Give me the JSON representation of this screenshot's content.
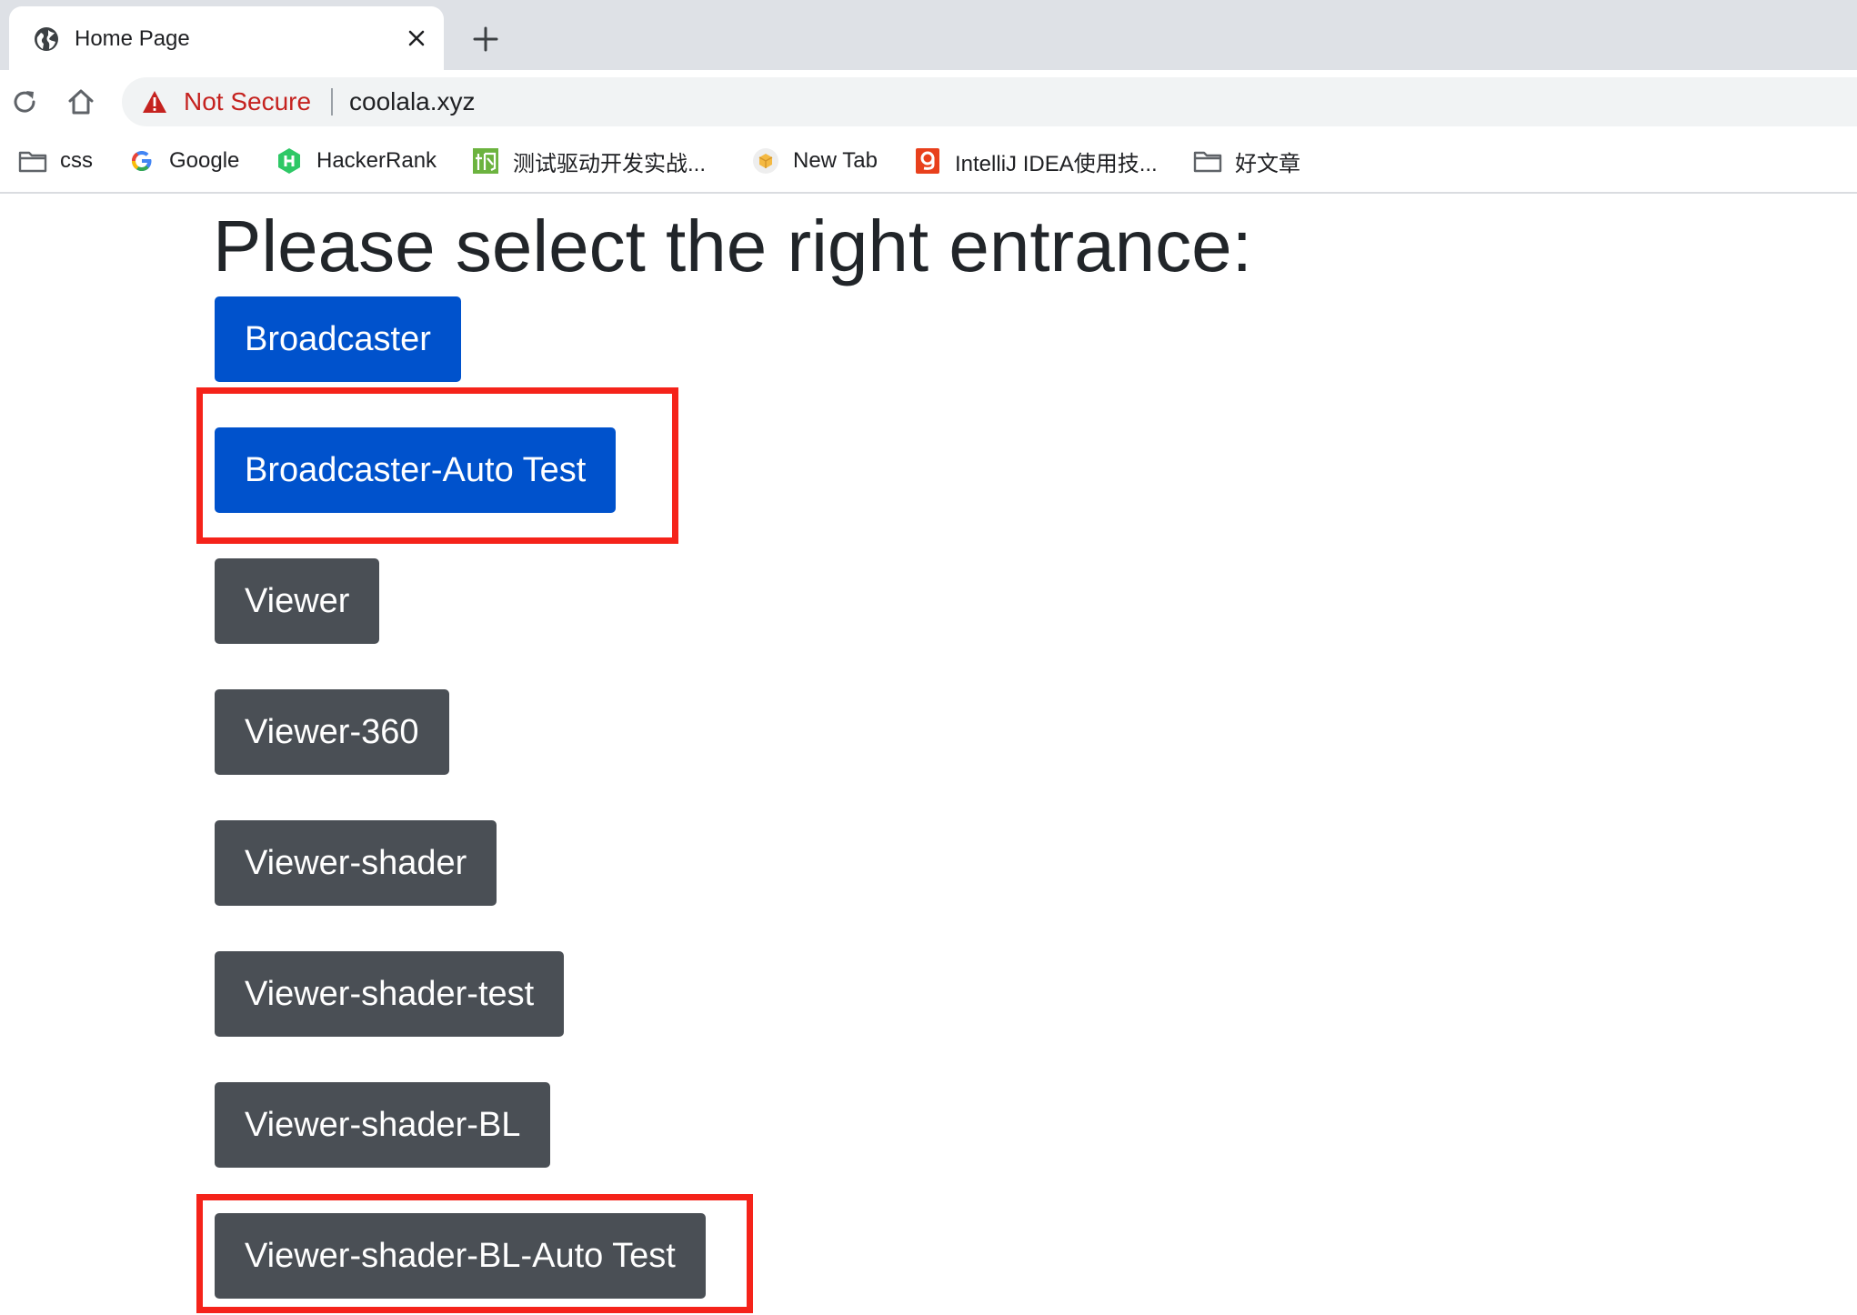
{
  "tab": {
    "title": "Home Page",
    "favicon": "globe-icon"
  },
  "toolbar": {
    "security_label": "Not Secure",
    "url": "coolala.xyz"
  },
  "bookmarks": [
    {
      "label": "css",
      "icon": "folder-icon"
    },
    {
      "label": "Google",
      "icon": "google-icon"
    },
    {
      "label": "HackerRank",
      "icon": "hackerrank-icon"
    },
    {
      "label": "测试驱动开发实战...",
      "icon": "bookmark-favicon"
    },
    {
      "label": "New Tab",
      "icon": "new-tab-favicon"
    },
    {
      "label": "IntelliJ IDEA使用技...",
      "icon": "intellij-favicon"
    },
    {
      "label": "好文章",
      "icon": "folder-icon"
    }
  ],
  "page": {
    "heading": "Please select the right entrance:",
    "buttons": [
      {
        "label": "Broadcaster",
        "style": "primary",
        "highlighted": false
      },
      {
        "label": "Broadcaster-Auto Test",
        "style": "primary",
        "highlighted": true
      },
      {
        "label": "Viewer",
        "style": "secondary",
        "highlighted": false
      },
      {
        "label": "Viewer-360",
        "style": "secondary",
        "highlighted": false
      },
      {
        "label": "Viewer-shader",
        "style": "secondary",
        "highlighted": false
      },
      {
        "label": "Viewer-shader-test",
        "style": "secondary",
        "highlighted": false
      },
      {
        "label": "Viewer-shader-BL",
        "style": "secondary",
        "highlighted": false
      },
      {
        "label": "Viewer-shader-BL-Auto Test",
        "style": "secondary",
        "highlighted": true
      }
    ]
  },
  "colors": {
    "primary": "#0052cc",
    "secondary": "#4a4f55",
    "highlight": "#f5231a",
    "not_secure": "#c5221f"
  }
}
